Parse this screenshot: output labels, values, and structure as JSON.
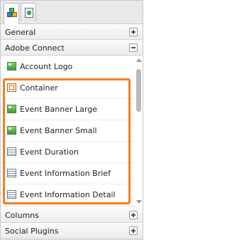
{
  "tabs": [
    {
      "icon": "components-icon",
      "active": true
    },
    {
      "icon": "page-properties-icon",
      "active": false
    }
  ],
  "sections": {
    "general": {
      "label": "General",
      "state": "collapsed"
    },
    "adobe_connect": {
      "label": "Adobe Connect",
      "state": "expanded"
    },
    "columns": {
      "label": "Columns",
      "state": "collapsed"
    },
    "social_plugins": {
      "label": "Social Plugins",
      "state": "collapsed"
    }
  },
  "items": [
    {
      "label": "Account Logo",
      "icon": "image-icon"
    },
    {
      "label": "Container",
      "icon": "container-icon"
    },
    {
      "label": "Event Banner Large",
      "icon": "image-icon"
    },
    {
      "label": "Event Banner Small",
      "icon": "image-icon"
    },
    {
      "label": "Event Duration",
      "icon": "text-icon"
    },
    {
      "label": "Event Information Brief",
      "icon": "text-icon"
    },
    {
      "label": "Event Information Detail",
      "icon": "text-icon"
    }
  ],
  "colors": {
    "highlight": "#f08021"
  }
}
